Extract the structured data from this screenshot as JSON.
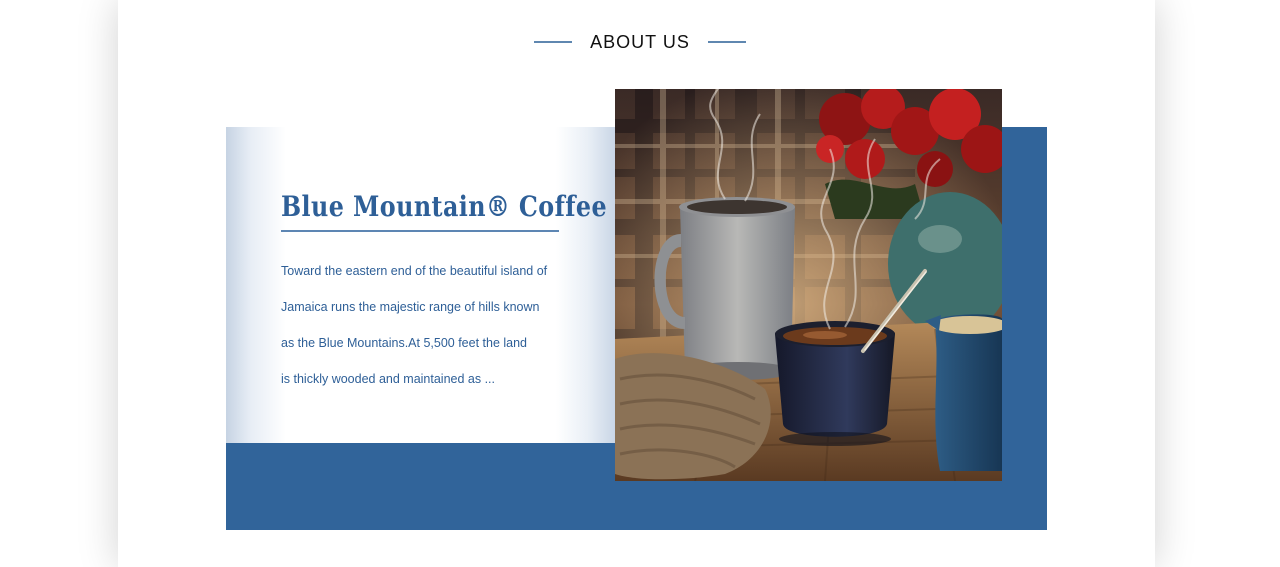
{
  "section": {
    "title": "ABOUT US"
  },
  "card": {
    "title": "Blue Mountain® Coffee",
    "lines": [
      "Toward the eastern end of the beautiful island of",
      "Jamaica runs the majestic range of hills known",
      "as the Blue Mountains.At 5,500 feet the land",
      "is thickly wooded and maintained as ..."
    ]
  },
  "colors": {
    "accent_blue": "#31649a",
    "heading_blue": "#2e5f97",
    "rule_blue": "#5f87b0"
  },
  "image": {
    "subject": "steaming coffee cups with spoon, mug, red flowers and plaid background",
    "icon": "coffee-photo"
  }
}
